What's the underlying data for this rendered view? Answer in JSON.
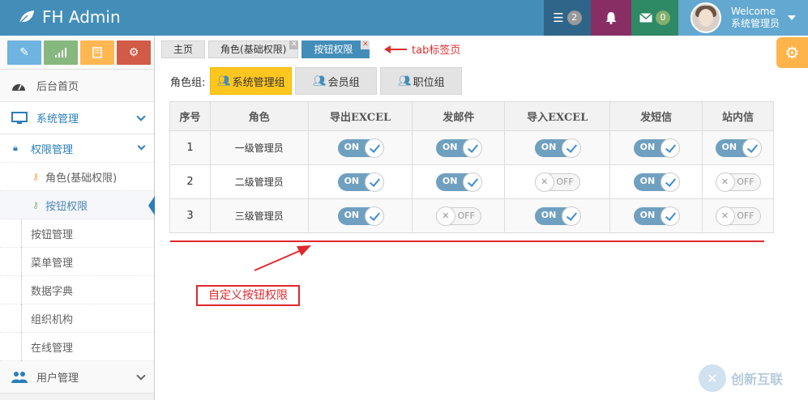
{
  "navbar": {
    "brand": "FH Admin",
    "tasks_count": "2",
    "mail_count": "0",
    "user_welcome": "Welcome",
    "user_name": "系统管理员"
  },
  "sidebar": {
    "home": "后台首页",
    "system_mgmt": "系统管理",
    "perm_mgmt": "权限管理",
    "role_base": "角色(基础权限)",
    "button_perm": "按钮权限",
    "items": [
      "按钮管理",
      "菜单管理",
      "数据字典",
      "组织机构",
      "在线管理"
    ],
    "user_mgmt": "用户管理"
  },
  "tabs": [
    {
      "label": "主页"
    },
    {
      "label": "角色(基础权限)"
    },
    {
      "label": "按钮权限"
    }
  ],
  "annotations": {
    "tab_note": "tab标签页",
    "custom_note": "自定义按钮权限"
  },
  "role_groups": {
    "label": "角色组:",
    "groups": [
      "系统管理组",
      "会员组",
      "职位组"
    ]
  },
  "table": {
    "headers": [
      "序号",
      "角色",
      "导出EXCEL",
      "发邮件",
      "导入EXCEL",
      "发短信",
      "站内信"
    ],
    "rows": [
      {
        "no": "1",
        "role": "一级管理员",
        "perms": [
          true,
          true,
          true,
          true,
          true
        ]
      },
      {
        "no": "2",
        "role": "二级管理员",
        "perms": [
          true,
          true,
          false,
          true,
          false
        ]
      },
      {
        "no": "3",
        "role": "三级管理员",
        "perms": [
          true,
          false,
          true,
          true,
          false
        ]
      }
    ],
    "on_label": "ON",
    "off_label": "OFF"
  },
  "watermark": "创新互联"
}
